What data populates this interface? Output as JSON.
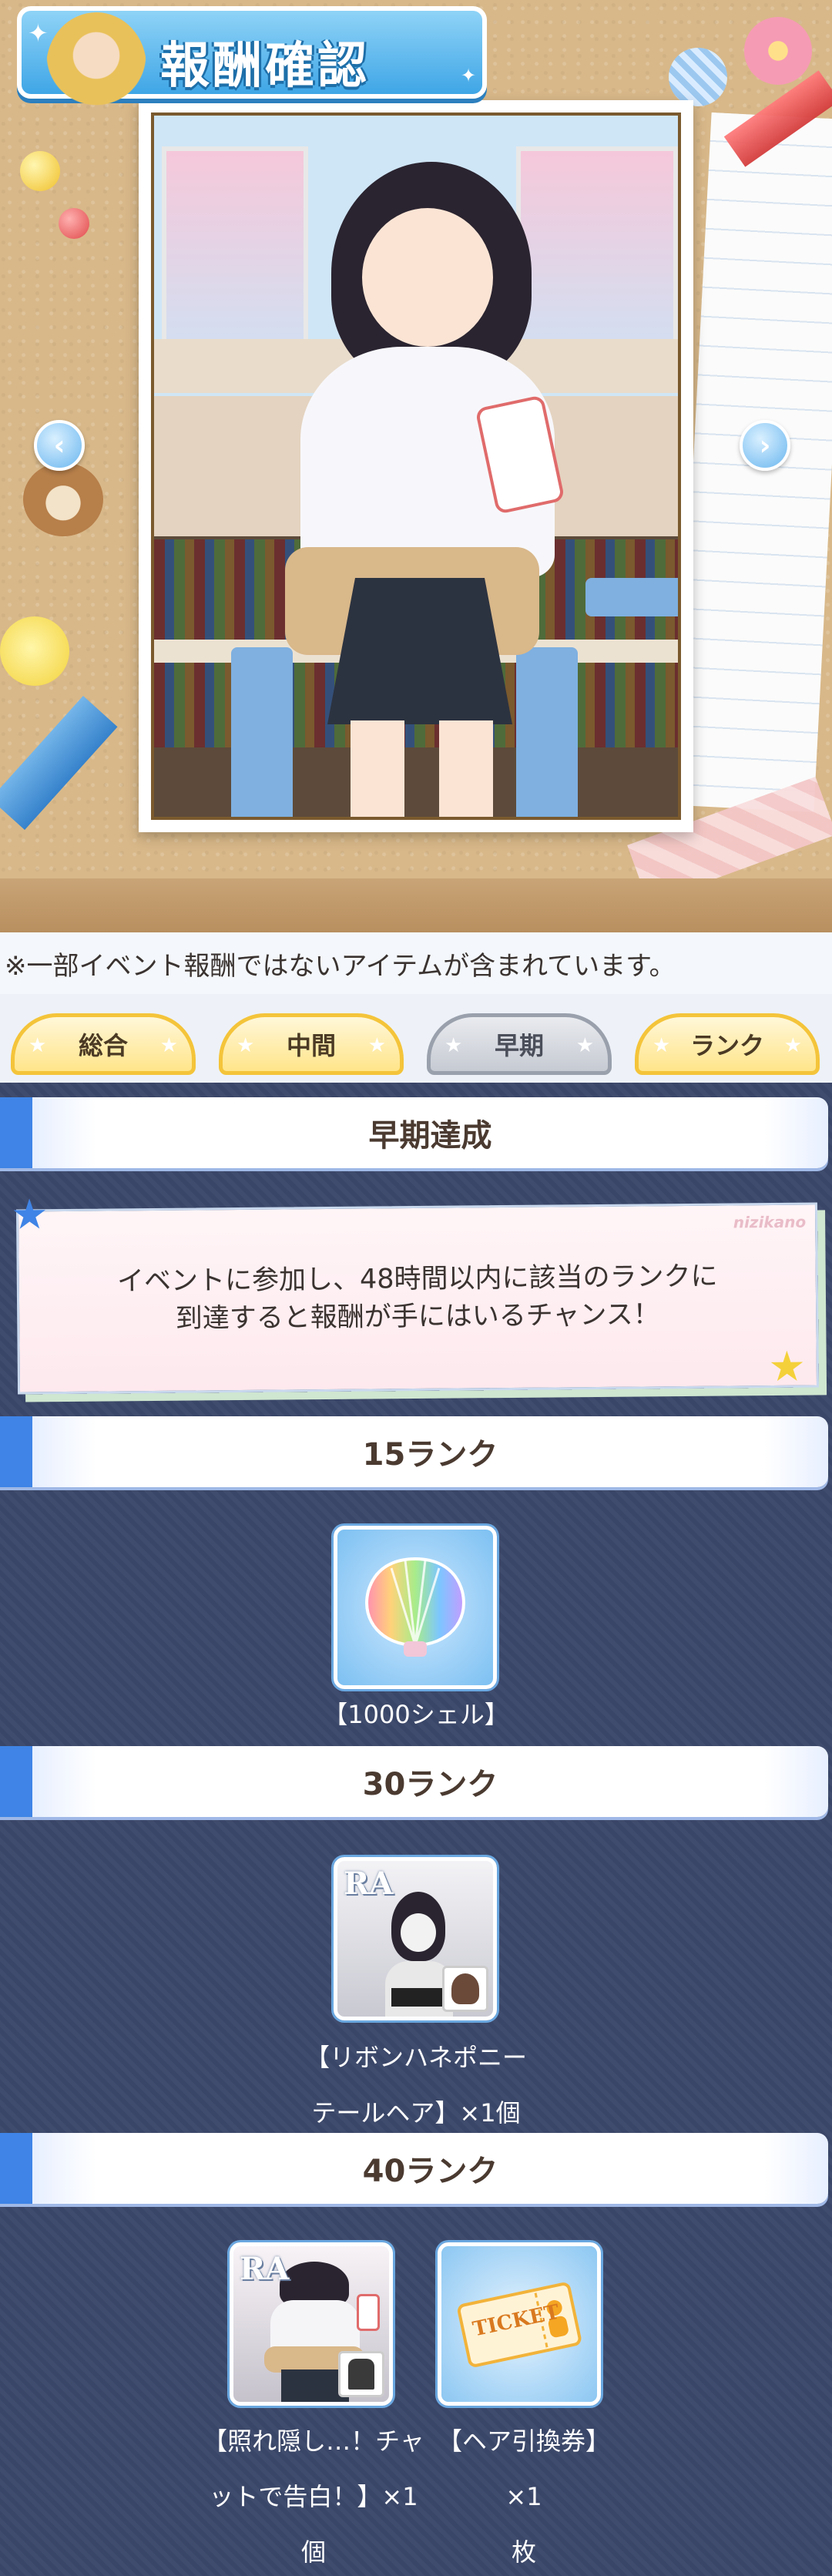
{
  "header": {
    "title": "報酬確認"
  },
  "notice": "※一部イベント報酬ではないアイテムが含まれています。",
  "tabs": [
    {
      "label": "総合",
      "active": false
    },
    {
      "label": "中間",
      "active": false
    },
    {
      "label": "早期",
      "active": true
    },
    {
      "label": "ランク",
      "active": false
    }
  ],
  "section": {
    "title": "早期達成",
    "description_line1": "イベントに参加し、48時間以内に該当のランクに",
    "description_line2": "到達すると報酬が手にはいるチャンス！",
    "watermark": "nizikano"
  },
  "ranks": [
    {
      "title": "15ランク",
      "items": [
        {
          "name_line1": "【1000シェル】",
          "name_line2": "",
          "name_line3": "",
          "rarity": "",
          "icon": "rainbow-shell-icon"
        }
      ]
    },
    {
      "title": "30ランク",
      "items": [
        {
          "name_line1": "【リボンハネポニー",
          "name_line2": "テールヘア】×1個",
          "name_line3": "",
          "rarity": "RA",
          "icon": "hair-item-icon"
        }
      ]
    },
    {
      "title": "40ランク",
      "items": [
        {
          "name_line1": "【照れ隠し…！チャ",
          "name_line2": "ットで告白！】×1",
          "name_line3": "個",
          "rarity": "RA",
          "icon": "costume-item-icon"
        },
        {
          "name_line1": "【ヘア引換券】×1",
          "name_line2": "枚",
          "name_line3": "",
          "rarity": "",
          "icon": "ticket-icon",
          "ticket_text": "TICKET"
        }
      ]
    }
  ],
  "colors": {
    "accent_blue": "#3f84e6",
    "tab_yellow": "#f4c43a",
    "panel_bg": "#3a4668"
  }
}
